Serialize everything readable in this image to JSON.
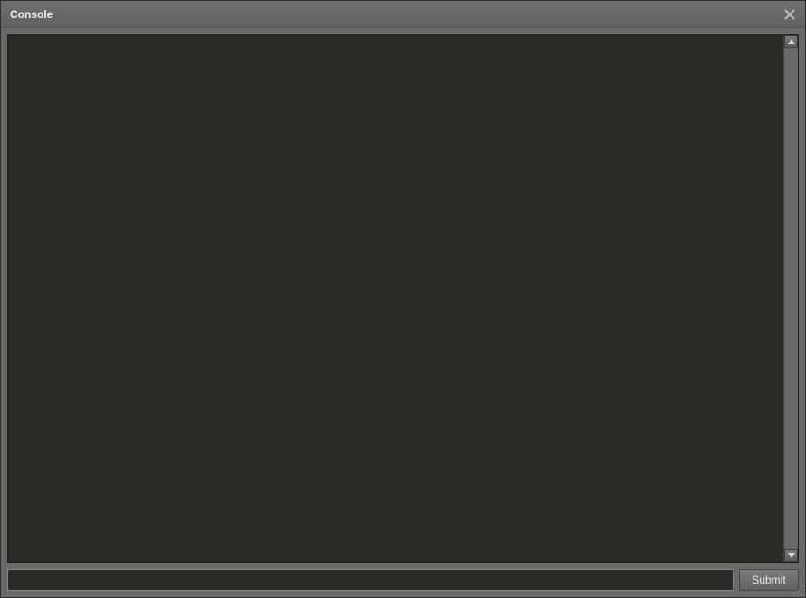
{
  "window": {
    "title": "Console"
  },
  "console": {
    "output_text": "",
    "command_value": "",
    "command_placeholder": ""
  },
  "controls": {
    "submit_label": "Submit"
  },
  "icons": {
    "close": "close-icon",
    "scroll_up": "scroll-up-icon",
    "scroll_down": "scroll-down-icon",
    "resize": "resize-grip-icon"
  }
}
